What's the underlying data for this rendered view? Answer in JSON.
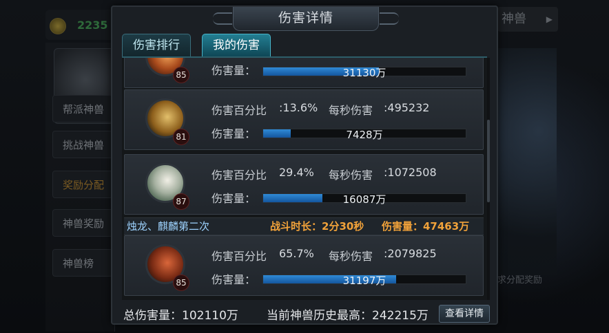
{
  "background": {
    "gold_amount": "2235",
    "side_menu": [
      "帮派神兽",
      "挑战神兽",
      "奖励分配",
      "神兽奖励",
      "神兽榜"
    ],
    "right_tab": "神兽",
    "right_caption": "求分配奖励"
  },
  "dialog": {
    "title": "伤害详情",
    "tabs": [
      {
        "label": "伤害排行",
        "active": false
      },
      {
        "label": "我的伤害",
        "active": true
      }
    ],
    "labels": {
      "percent": "伤害百分比",
      "dps": "每秒伤害",
      "damage": "伤害量："
    },
    "rows": [
      {
        "level": "85",
        "percent": "",
        "dps": "",
        "damage": "31130万",
        "fill_pct": 57,
        "avatar": "fire-hero-portrait"
      },
      {
        "level": "81",
        "percent": ":13.6%",
        "dps": ":495232",
        "damage": "7428万",
        "fill_pct": 13.6,
        "avatar": "golden-general-portrait"
      },
      {
        "level": "87",
        "percent": "29.4%",
        "dps": ":1072508",
        "damage": "16087万",
        "fill_pct": 29.4,
        "avatar": "white-haired-hero-portrait"
      },
      {
        "level": "85",
        "percent": "65.7%",
        "dps": ":2079825",
        "damage": "31197万",
        "fill_pct": 65.7,
        "avatar": "monkey-king-portrait"
      }
    ],
    "battle": {
      "name": "烛龙、麒麟第二次",
      "duration": "战斗时长：2分30秒",
      "damage": "伤害量：47463万"
    },
    "footer": {
      "total": "总伤害量：102110万",
      "best": "当前神兽历史最高：242215万",
      "detail_button": "查看详情"
    }
  },
  "colors": {
    "accent_tab": "#237f93",
    "bar_fill": "#2f8ad6",
    "battle_highlight": "#f1a23a",
    "battle_name": "#9ed3ff"
  }
}
